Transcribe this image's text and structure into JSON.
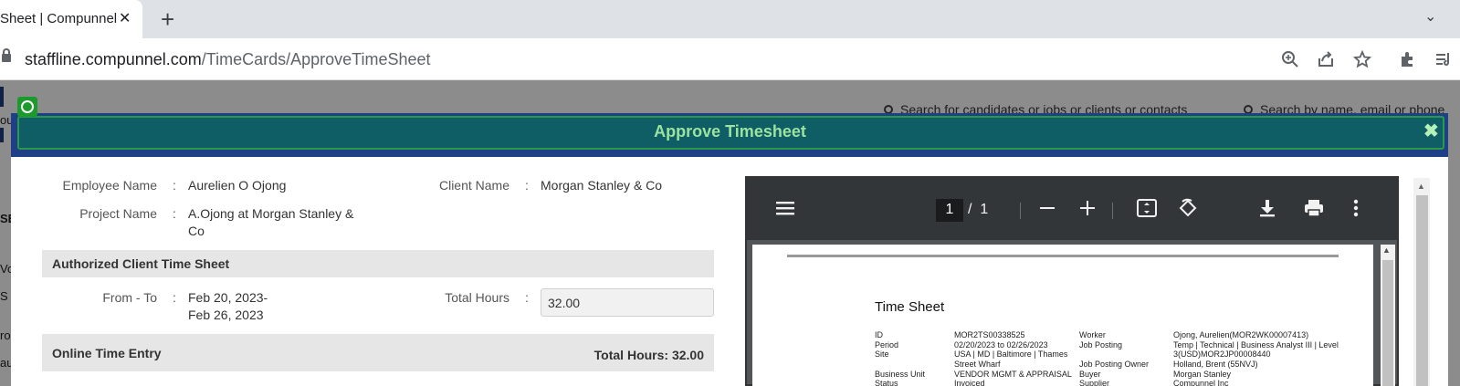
{
  "browser": {
    "tab_title": "Sheet | Compunnel",
    "tab_close": "✕",
    "new_tab": "+",
    "tab_menu": "⌄",
    "url_host": "staffline.compunnel.com",
    "url_path": "/TimeCards/ApproveTimeSheet",
    "toolbar_icons": [
      "zoom-icon",
      "share-icon",
      "star-icon",
      "extensions-icon",
      "media-icon"
    ]
  },
  "background": {
    "search_candidates_placeholder": "Search for candidates or jobs or clients or contacts",
    "search_name_placeholder": "Search by name, email or phone",
    "side_fragments": [
      "ou",
      "SE",
      "Vo",
      "S",
      "ro",
      "au"
    ]
  },
  "modal": {
    "title": "Approve Timesheet",
    "close_icon": "✖",
    "employee_name_label": "Employee Name",
    "employee_name": "Aurelien O Ojong",
    "client_name_label": "Client Name",
    "client_name": "Morgan Stanley & Co",
    "project_name_label": "Project Name",
    "project_name_line1": "A.Ojong at Morgan Stanley &",
    "project_name_line2": "Co",
    "colon": ":",
    "section_authorized": "Authorized Client Time Sheet",
    "from_to_label": "From - To",
    "from_line1": "Feb 20, 2023-",
    "from_line2": "Feb 26, 2023",
    "total_hours_label": "Total Hours",
    "total_hours_value": "32.00",
    "section_online": "Online Time Entry",
    "online_total": "Total Hours: 32.00"
  },
  "pdf": {
    "page_current": "1",
    "page_separator": "/",
    "page_total": "1",
    "icons": [
      "menu-icon",
      "zoom-out-icon",
      "zoom-in-icon",
      "fit-page-icon",
      "rotate-icon",
      "download-icon",
      "print-icon",
      "more-icon"
    ],
    "doc_title": "Time Sheet",
    "rows": [
      {
        "k1": "ID",
        "v1": "MOR2TS00338525",
        "k2": "Worker",
        "v2": "Ojong, Aurelien(MOR2WK00007413)"
      },
      {
        "k1": "Period",
        "v1": "02/20/2023 to 02/26/2023",
        "k2": "Job Posting",
        "v2": "Temp | Technical | Business Analyst III | Level"
      },
      {
        "k1": "Site",
        "v1": "USA | MD | Baltimore | Thames",
        "k2": "",
        "v2": "3(USD)MOR2JP00008440"
      },
      {
        "k1": "",
        "v1": "Street Wharf",
        "k2": "Job Posting Owner",
        "v2": "Holland, Brent (55NVJ)"
      },
      {
        "k1": "Business Unit",
        "v1": "VENDOR MGMT & APPRAISAL",
        "k2": "Buyer",
        "v2": "Morgan Stanley"
      },
      {
        "k1": "Status",
        "v1": "Invoiced",
        "k2": "Supplier",
        "v2": "Compunnel Inc"
      }
    ]
  }
}
